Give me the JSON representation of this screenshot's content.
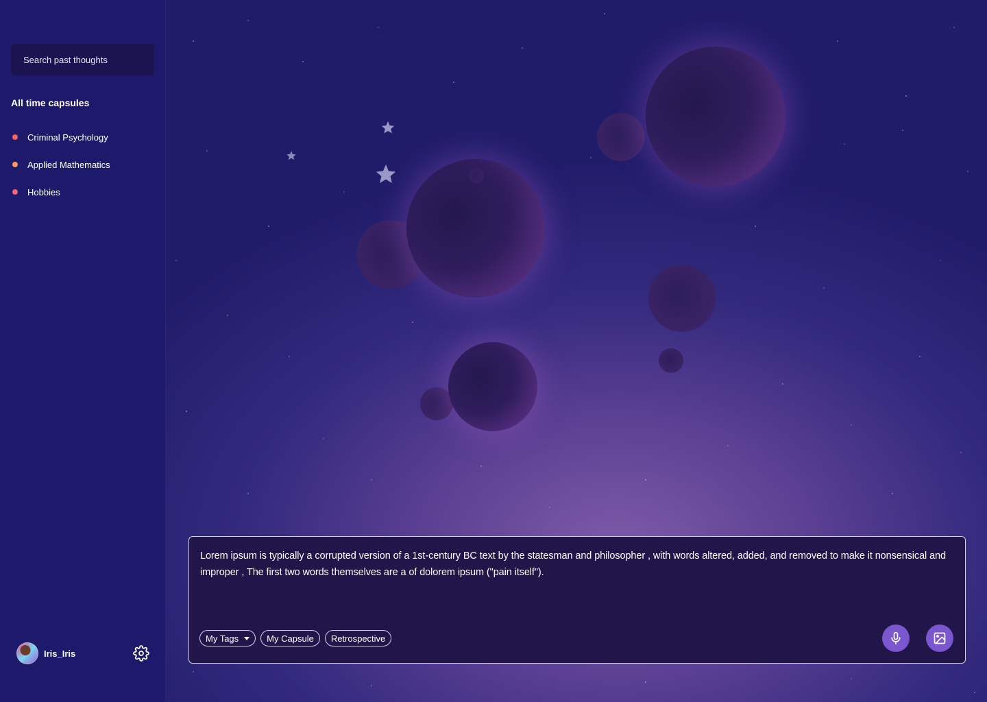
{
  "sidebar": {
    "search": {
      "placeholder": "Search past thoughts"
    },
    "section_title": "All time capsules",
    "capsules": [
      {
        "label": "Criminal Psychology",
        "color": "#f2655e"
      },
      {
        "label": "Applied Mathematics",
        "color": "#f29b5e"
      },
      {
        "label": "Hobbies",
        "color": "#f2657a"
      }
    ],
    "user": {
      "name": "Iris_Iris",
      "avatar_icon": "avatar-icon",
      "settings_icon": "gear-icon"
    }
  },
  "composer": {
    "text": "Lorem ipsum is typically a corrupted version of a 1st-century BC text by the statesman and philosopher , with words altered, added, and removed to make it nonsensical and improper , The first two words themselves are a of dolorem ipsum (\"pain itself\").",
    "tags": [
      {
        "label": "My Tags",
        "has_dropdown": true
      },
      {
        "label": "My Capsule",
        "has_dropdown": false
      },
      {
        "label": "Retrospective",
        "has_dropdown": false
      }
    ],
    "mic_icon": "microphone-icon",
    "image_icon": "image-icon"
  },
  "colors": {
    "sidebar_bg": "#1d1a6b",
    "accent": "#7a57cf",
    "composer_bg": "#21154a"
  }
}
